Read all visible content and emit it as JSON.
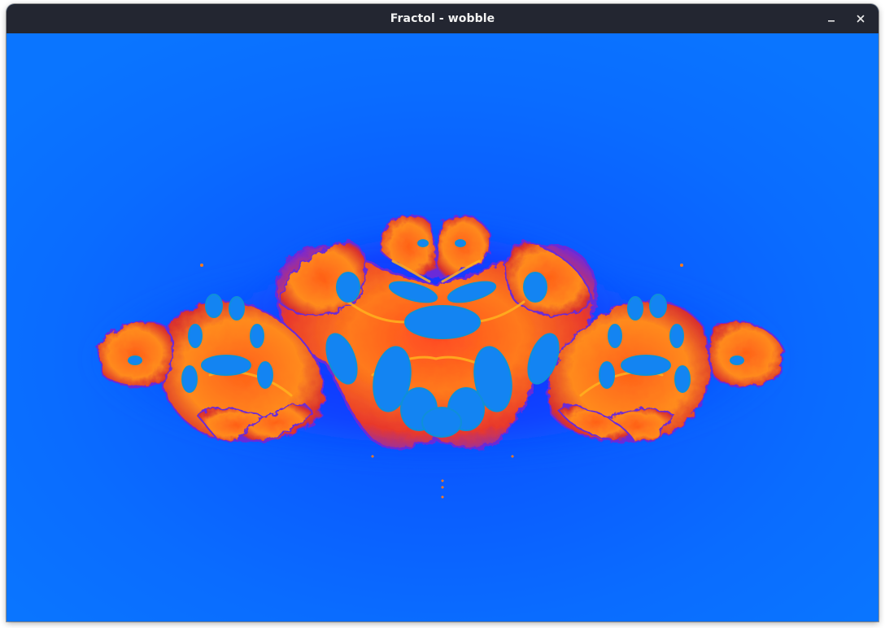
{
  "window": {
    "title": "Fractol - wobble"
  },
  "controls": {
    "minimize_icon": "minimize-icon",
    "close_icon": "close-icon"
  },
  "colors": {
    "titlebar": "#232631",
    "background": "#0a71ff",
    "halo": "#0d47ff",
    "edge_purple": "#6a2bd8",
    "body_orange": "#ff6a1a",
    "body_red": "#e8362a",
    "highlight": "#ffb21f",
    "interior": "#1384f2"
  }
}
